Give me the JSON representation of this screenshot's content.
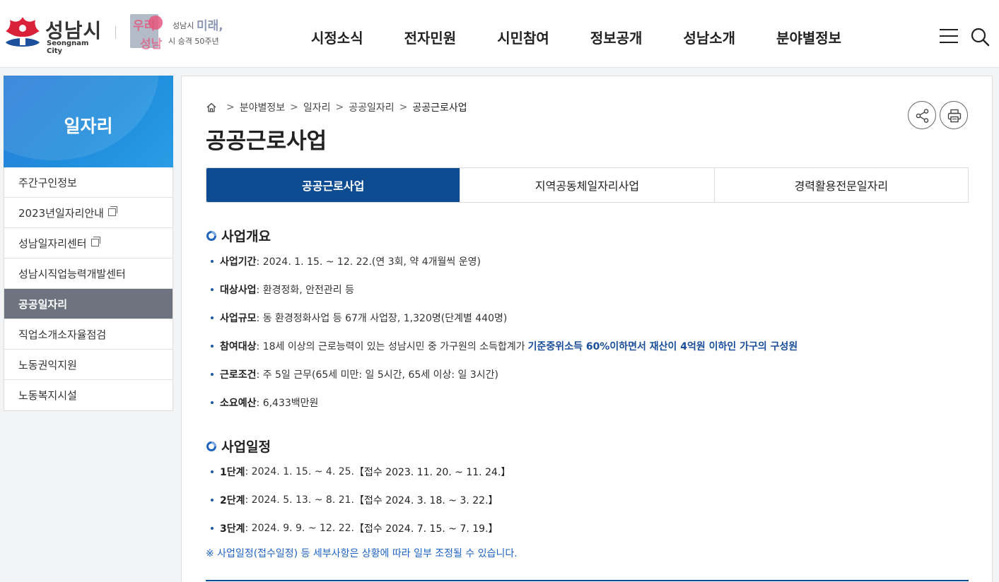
{
  "header": {
    "logo_ko": "성남시",
    "logo_en": "Seongnam City",
    "slogan_line1a": "우리",
    "slogan_line1b": "미래,",
    "slogan_line2": "성남",
    "slogan_sub1": "성남시",
    "slogan_sub2": "시 승격 50주년",
    "nav": [
      "시정소식",
      "전자민원",
      "시민참여",
      "정보공개",
      "성남소개",
      "분야별정보"
    ]
  },
  "sidebar": {
    "title": "일자리",
    "items": [
      {
        "label": "주간구인정보",
        "external": false,
        "active": false
      },
      {
        "label": "2023년일자리안내",
        "external": true,
        "active": false
      },
      {
        "label": "성남일자리센터",
        "external": true,
        "active": false
      },
      {
        "label": "성남시직업능력개발센터",
        "external": false,
        "active": false
      },
      {
        "label": "공공일자리",
        "external": false,
        "active": true
      },
      {
        "label": "직업소개소자율점검",
        "external": false,
        "active": false
      },
      {
        "label": "노동권익지원",
        "external": false,
        "active": false
      },
      {
        "label": "노동복지시설",
        "external": false,
        "active": false
      }
    ]
  },
  "breadcrumb": [
    "분야별정보",
    "일자리",
    "공공일자리",
    "공공근로사업"
  ],
  "page_title": "공공근로사업",
  "tabs": [
    {
      "label": "공공근로사업",
      "active": true
    },
    {
      "label": "지역공동체일자리사업",
      "active": false
    },
    {
      "label": "경력활용전문일자리",
      "active": false
    }
  ],
  "overview": {
    "heading": "사업개요",
    "items": [
      {
        "label": "사업기간",
        "text": " : 2024. 1. 15. ~ 12. 22.(연 3회, 약 4개월씩 운영)",
        "highlight": ""
      },
      {
        "label": "대상사업",
        "text": " : 환경정화, 안전관리 등",
        "highlight": ""
      },
      {
        "label": "사업규모",
        "text": " : 동 환경정화사업 등 67개 사업장, 1,320명(단계별 440명)",
        "highlight": ""
      },
      {
        "label": "참여대상",
        "text": " : 18세 이상의 근로능력이 있는 성남시민 중 가구원의 소득합계가",
        "highlight": "기준중위소득 60%이하면서 재산이 4억원 이하인 가구의 구성원"
      },
      {
        "label": "근로조건",
        "text": " : 주 5일 근무(65세 미만: 일 5시간, 65세 이상: 일 3시간)",
        "highlight": ""
      },
      {
        "label": "소요예산",
        "text": " : 6,433백만원",
        "highlight": ""
      }
    ]
  },
  "schedule": {
    "heading": "사업일정",
    "items": [
      {
        "label": "1단계",
        "text": " : 2024. 1. 15. ~ 4. 25.",
        "bracket": "【접수 2023. 11. 20. ~ 11. 24.】"
      },
      {
        "label": "2단계",
        "text": " : 2024. 5. 13. ~ 8. 21.",
        "bracket": "【접수 2024. 3. 18. ~ 3. 22.】"
      },
      {
        "label": "3단계",
        "text": " : 2024. 9. 9. ~ 12. 22.",
        "bracket": "【접수 2024. 7. 15. ~ 7. 19.】"
      }
    ],
    "note": "※ 사업일정(접수일정) 등 세부사항은 상황에 따라 일부 조정될 수 있습니다."
  },
  "colors": {
    "primary": "#0e4c92",
    "sidebar_title": "#2b7cd6",
    "sidebar_active": "#6e7380",
    "note": "#1e63c4"
  }
}
